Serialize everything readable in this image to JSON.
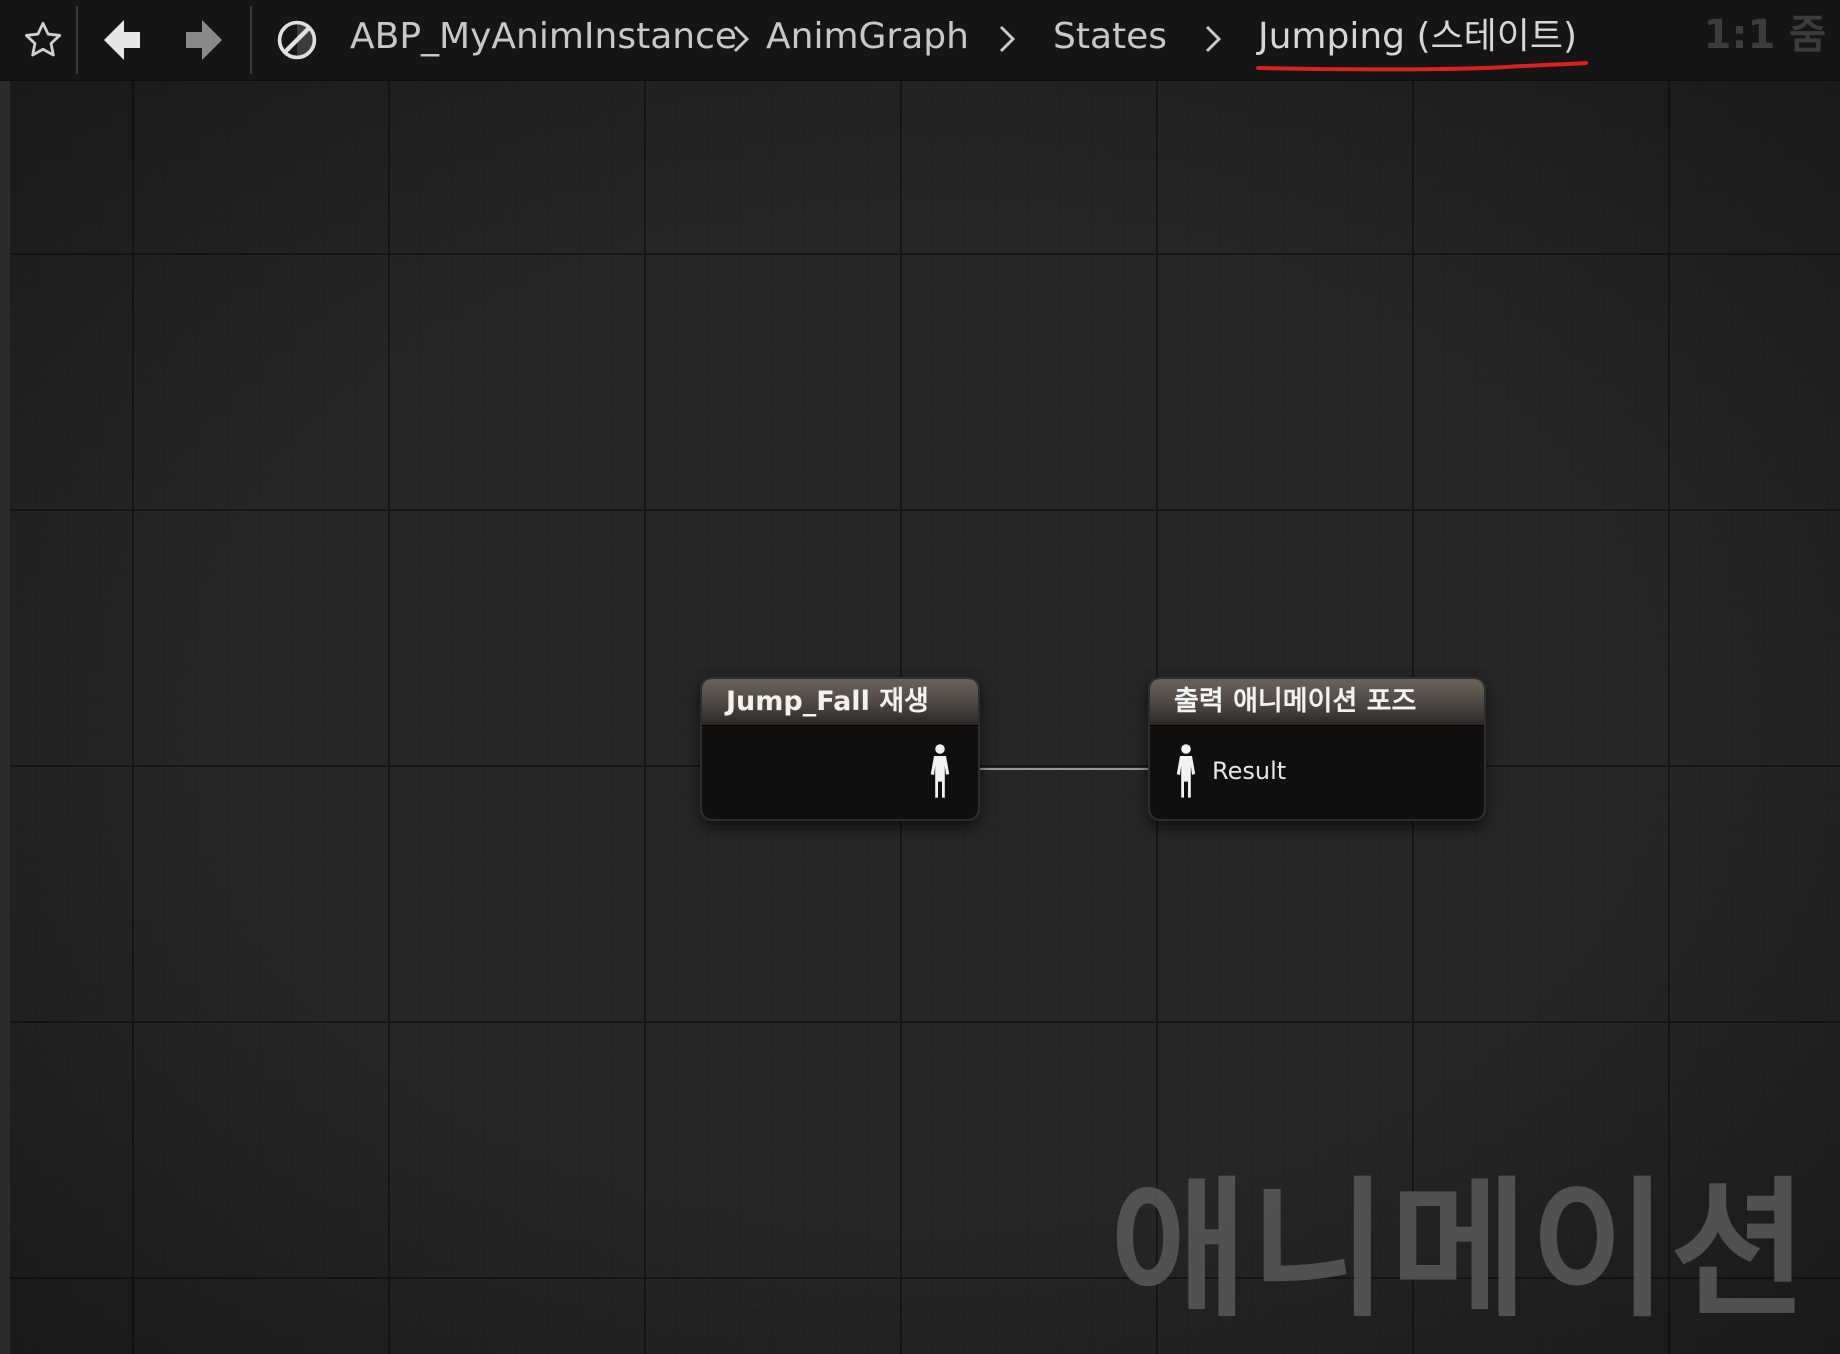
{
  "toolbar": {
    "bookmark_icon": "star-icon",
    "back_icon": "arrow-left-icon",
    "forward_icon": "arrow-right-icon",
    "graph_icon": "graph-slash-icon",
    "breadcrumbs": [
      "ABP_MyAnimInstance",
      "AnimGraph",
      "States",
      "Jumping (스테이트)"
    ],
    "zoom_label": "1:1 줌",
    "underline_color": "#d7221f"
  },
  "graph": {
    "watermark": "애니메이션",
    "nodes": [
      {
        "title": "Jump_Fall 재생",
        "pin_icon": "pose-pin-icon"
      },
      {
        "title": "출력 애니메이션 포즈",
        "pin_icon": "pose-pin-icon",
        "pin_label": "Result"
      }
    ]
  }
}
